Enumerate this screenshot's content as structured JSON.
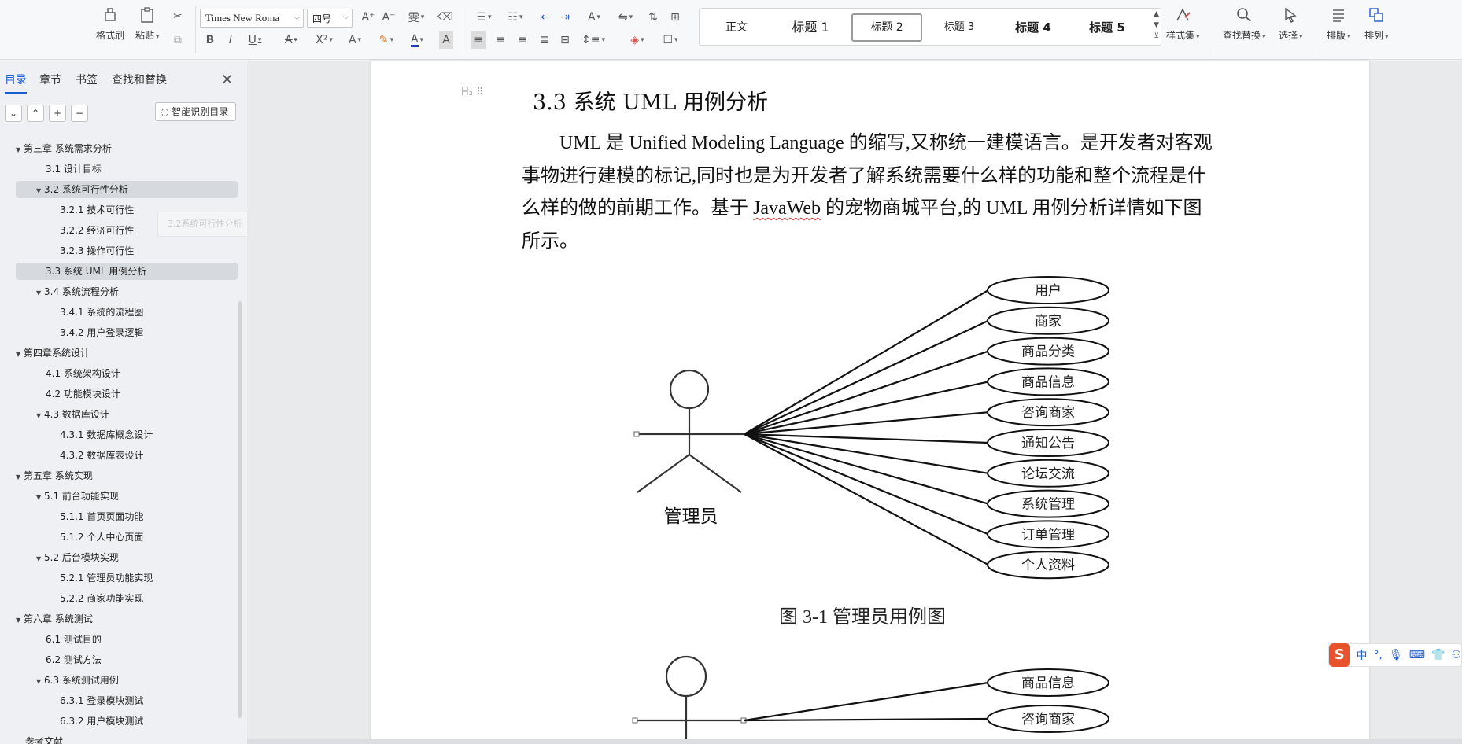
{
  "toolbar": {
    "format_painter": "格式刷",
    "paste": "粘贴",
    "font_name": "Times New Roma",
    "font_size": "四号",
    "styles": [
      "正文",
      "标题 1",
      "标题 2",
      "标题 3",
      "标题 4",
      "标题 5"
    ],
    "active_style": "标题 2",
    "style_set": "样式集",
    "find_replace": "查找替换",
    "select": "选择",
    "layout": "排版",
    "arrange": "排列"
  },
  "sidebar": {
    "tabs": [
      "目录",
      "章节",
      "书签",
      "查找和替换"
    ],
    "smart_toc": "智能识别目录",
    "hover_tip": "3.2系统可行性分析",
    "toc": [
      {
        "level": 1,
        "label": "第三章  系统需求分析",
        "arrow": true
      },
      {
        "level": 2,
        "label": "3.1 设计目标",
        "arrow": false
      },
      {
        "level": 2,
        "label": "3.2 系统可行性分析",
        "arrow": true,
        "selected": true
      },
      {
        "level": 3,
        "label": "3.2.1 技术可行性",
        "arrow": false
      },
      {
        "level": 3,
        "label": "3.2.2 经济可行性",
        "arrow": false
      },
      {
        "level": 3,
        "label": "3.2.3 操作可行性",
        "arrow": false
      },
      {
        "level": 2,
        "label": "3.3 系统 UML 用例分析",
        "arrow": false,
        "selected": true
      },
      {
        "level": 2,
        "label": "3.4 系统流程分析",
        "arrow": true
      },
      {
        "level": 3,
        "label": "3.4.1 系统的流程图",
        "arrow": false
      },
      {
        "level": 3,
        "label": "3.4.2 用户登录逻辑",
        "arrow": false
      },
      {
        "level": 1,
        "label": "第四章系统设计",
        "arrow": true
      },
      {
        "level": 2,
        "label": "4.1  系统架构设计",
        "arrow": false
      },
      {
        "level": 2,
        "label": "4.2 功能模块设计",
        "arrow": false
      },
      {
        "level": 2,
        "label": "4.3  数据库设计",
        "arrow": true
      },
      {
        "level": 3,
        "label": "4.3.1 数据库概念设计",
        "arrow": false
      },
      {
        "level": 3,
        "label": "4.3.2  数据库表设计",
        "arrow": false
      },
      {
        "level": 1,
        "label": "第五章  系统实现",
        "arrow": true
      },
      {
        "level": 2,
        "label": "5.1 前台功能实现",
        "arrow": true
      },
      {
        "level": 3,
        "label": "5.1.1 首页页面功能",
        "arrow": false
      },
      {
        "level": 3,
        "label": "5.1.2 个人中心页面",
        "arrow": false
      },
      {
        "level": 2,
        "label": "5.2 后台模块实现",
        "arrow": true
      },
      {
        "level": 3,
        "label": "5.2.1 管理员功能实现",
        "arrow": false
      },
      {
        "level": 3,
        "label": "5.2.2 商家功能实现",
        "arrow": false
      },
      {
        "level": 1,
        "label": "第六章  系统测试",
        "arrow": true
      },
      {
        "level": 2,
        "label": "6.1 测试目的",
        "arrow": false
      },
      {
        "level": 2,
        "label": "6.2 测试方法",
        "arrow": false
      },
      {
        "level": 2,
        "label": "6.3 系统测试用例",
        "arrow": true
      },
      {
        "level": 3,
        "label": "6.3.1 登录模块测试",
        "arrow": false
      },
      {
        "level": 3,
        "label": "6.3.2 用户模块测试",
        "arrow": false
      },
      {
        "level": 1,
        "label": "参考文献",
        "arrow": false
      }
    ]
  },
  "document": {
    "heading_marker": "H₂",
    "heading": "3.3 系统 UML 用例分析",
    "para_1": "UML 是  Unified Modeling Language 的缩写,又称统一建模语言。是开发者对客观事物进行建模的标记,同时也是为开发者了解系统需要什么样的功能和整个流程是什么样的做的前期工作。基于 ",
    "para_wavy": "JavaWeb",
    "para_2": " 的宠物商城平台,的 UML 用例分析详情如下图所示。",
    "actor_label": "管理员",
    "use_cases": [
      "用户",
      "商家",
      "商品分类",
      "商品信息",
      "咨询商家",
      "通知公告",
      "论坛交流",
      "系统管理",
      "订单管理",
      "个人资料"
    ],
    "caption": "图 3-1  管理员用例图",
    "use_cases_2": [
      "商品信息",
      "咨询商家"
    ]
  },
  "ime": {
    "mode": "中"
  }
}
